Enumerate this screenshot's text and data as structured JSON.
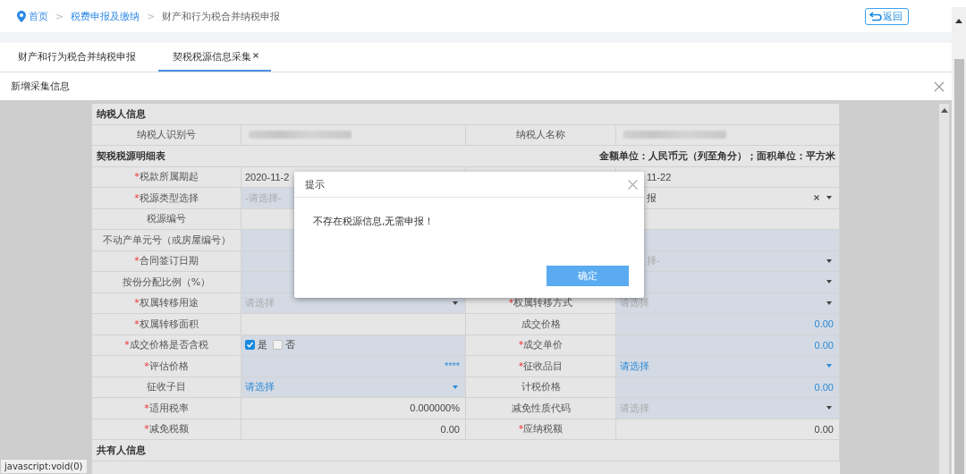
{
  "breadcrumb": [
    {
      "label": "首页",
      "link": true,
      "kind": "home"
    },
    {
      "separator": ">",
      "label": "税费申报及缴纳",
      "link": true,
      "kind": "page"
    },
    {
      "separator": ">",
      "label": "财产和行为税合并纳税申报",
      "link": false,
      "kind": "page"
    }
  ],
  "back_button": {
    "label": "返回"
  },
  "tabs": [
    {
      "label": "财产和行为税合并纳税申报",
      "selected": false,
      "closable": false
    },
    {
      "label": "契税税源信息采集",
      "selected": true,
      "closable": true
    }
  ],
  "panel": {
    "title": "新增采集信息"
  },
  "form": {
    "sections": [
      {
        "title": "纳税人信息",
        "rows": [
          [
            {
              "label": "纳税人识别号",
              "input": {
                "kind": "redacted",
                "editable": false
              }
            },
            {
              "label": "纳税人名称",
              "input": {
                "kind": "redacted",
                "editable": false
              }
            }
          ]
        ]
      },
      {
        "title": "契税税源明细表",
        "note": "金额单位：人民币元（列至角分）；面积单位：平方米",
        "rows": [
          [
            {
              "marker": "*",
              "label": "税款所属期起",
              "input": {
                "kind": "text",
                "value": "2020-11-2",
                "editable": false
              }
            },
            {
              "input": {
                "kind": "text",
                "value": "11-22",
                "editable": false,
                "covered": true
              }
            }
          ],
          [
            {
              "marker": "*",
              "label": "税源类型选择",
              "input": {
                "kind": "select",
                "placeholder": "-请选择-",
                "editable": true
              }
            },
            {
              "input": {
                "kind": "select",
                "value": "报",
                "clearable": true,
                "editable": false,
                "covered": true
              }
            }
          ],
          [
            {
              "label": "税源编号",
              "input": {
                "kind": "text",
                "editable": false
              }
            },
            {
              "input": {
                "kind": "text",
                "editable": false
              }
            }
          ],
          [
            {
              "label": "不动产单元号（或房屋编号）",
              "input": {
                "kind": "text",
                "editable": true
              }
            },
            {
              "input": {
                "kind": "text",
                "editable": true
              }
            }
          ],
          [
            {
              "marker": "*",
              "label": "合同签订日期",
              "input": {
                "kind": "text",
                "editable": true
              }
            },
            {
              "input": {
                "kind": "select",
                "placeholder": "择-",
                "editable": true,
                "covered": true
              }
            }
          ],
          [
            {
              "label": "按份分配比例（%）",
              "input": {
                "kind": "text",
                "editable": true
              }
            },
            {
              "input": {
                "kind": "select",
                "editable": true
              }
            }
          ],
          [
            {
              "marker": "*",
              "label": "权属转移用途",
              "input": {
                "kind": "select",
                "placeholder": "请选择",
                "editable": true
              }
            },
            {
              "marker": "*",
              "label": "权属转移方式",
              "input": {
                "kind": "select",
                "placeholder": "请选择",
                "editable": true
              }
            }
          ],
          [
            {
              "marker": "*",
              "label": "权属转移面积",
              "input": {
                "kind": "text",
                "editable": false
              }
            },
            {
              "label": "成交价格",
              "input": {
                "kind": "text",
                "value": "0.00",
                "accent": true,
                "right_aligned": true,
                "editable": true
              }
            }
          ],
          [
            {
              "marker": "*",
              "label": "成交价格是否含税",
              "input": {
                "kind": "checks",
                "editable": true,
                "options": [
                  {
                    "label": "是",
                    "checked": true
                  },
                  {
                    "label": "否",
                    "checked": false
                  }
                ]
              }
            },
            {
              "marker": "*",
              "label": "成交单价",
              "input": {
                "kind": "text",
                "value": "0.00",
                "accent": true,
                "right_aligned": true,
                "editable": true
              }
            }
          ],
          [
            {
              "marker": "*",
              "label": "评估价格",
              "input": {
                "kind": "text",
                "value": "****",
                "accent": true,
                "right_aligned": true,
                "editable": true
              }
            },
            {
              "marker": "*",
              "label": "征收品目",
              "input": {
                "kind": "select",
                "value": "请选择",
                "accent": true,
                "editable": true
              }
            }
          ],
          [
            {
              "label": "征收子目",
              "input": {
                "kind": "select",
                "value": "请选择",
                "accent": true,
                "editable": true
              }
            },
            {
              "label": "计税价格",
              "input": {
                "kind": "text",
                "value": "0.00",
                "accent": true,
                "right_aligned": true,
                "editable": true
              }
            }
          ],
          [
            {
              "marker": "*",
              "label": "适用税率",
              "input": {
                "kind": "text",
                "value": "0.000000%",
                "right_aligned": true,
                "editable": false
              }
            },
            {
              "label": "减免性质代码",
              "input": {
                "kind": "select",
                "placeholder": "请选择",
                "editable": true
              }
            }
          ],
          [
            {
              "marker": "*",
              "label": "减免税额",
              "input": {
                "kind": "text",
                "value": "0.00",
                "right_aligned": true,
                "editable": false
              }
            },
            {
              "marker": "*",
              "label": "应纳税额",
              "input": {
                "kind": "text",
                "value": "0.00",
                "right_aligned": true,
                "editable": false
              }
            }
          ]
        ]
      },
      {
        "title": "共有人信息"
      }
    ]
  },
  "dialog": {
    "title": "提示",
    "message": "不存在税源信息,无需申报！",
    "button": "确定"
  },
  "status_bar": "javascript:void(0)"
}
